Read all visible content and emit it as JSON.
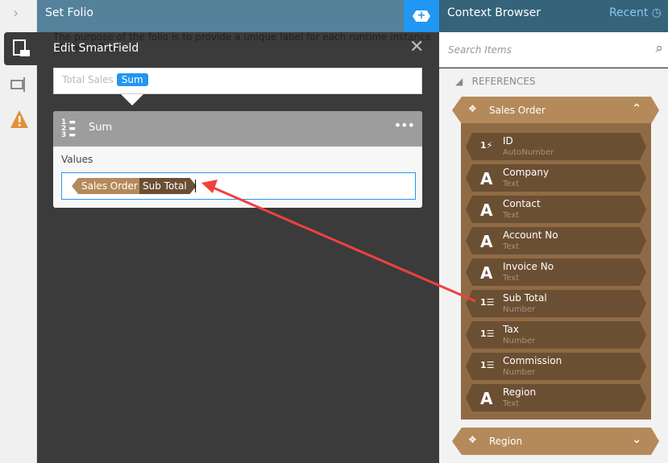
{
  "main": {
    "title": "Set Folio",
    "description": "The purpose of the folio is to provide a unique label for each runtime instance of a workflow"
  },
  "dialog": {
    "title": "Edit SmartField",
    "field_name": "Total Sales",
    "field_badge": "Sum",
    "function_name": "Sum",
    "values_label": "Values",
    "tokens": [
      "Sales Order",
      "Sub Total"
    ]
  },
  "context": {
    "title": "Context Browser",
    "recent": "Recent",
    "search_placeholder": "Search Items",
    "section": "REFERENCES",
    "groups": [
      {
        "label": "Sales Order"
      },
      {
        "label": "Region"
      }
    ],
    "items": [
      {
        "name": "ID",
        "type": "AutoNumber",
        "icon": "autonumber"
      },
      {
        "name": "Company",
        "type": "Text",
        "icon": "text"
      },
      {
        "name": "Contact",
        "type": "Text",
        "icon": "text"
      },
      {
        "name": "Account No",
        "type": "Text",
        "icon": "text"
      },
      {
        "name": "Invoice No",
        "type": "Text",
        "icon": "text"
      },
      {
        "name": "Sub Total",
        "type": "Number",
        "icon": "number"
      },
      {
        "name": "Tax",
        "type": "Number",
        "icon": "number"
      },
      {
        "name": "Commission",
        "type": "Number",
        "icon": "number"
      },
      {
        "name": "Region",
        "type": "Text",
        "icon": "text"
      }
    ]
  },
  "colors": {
    "accent": "#2196f3",
    "reference": "#b58a5a",
    "field": "#6b4f33",
    "arrow": "#f04040"
  }
}
